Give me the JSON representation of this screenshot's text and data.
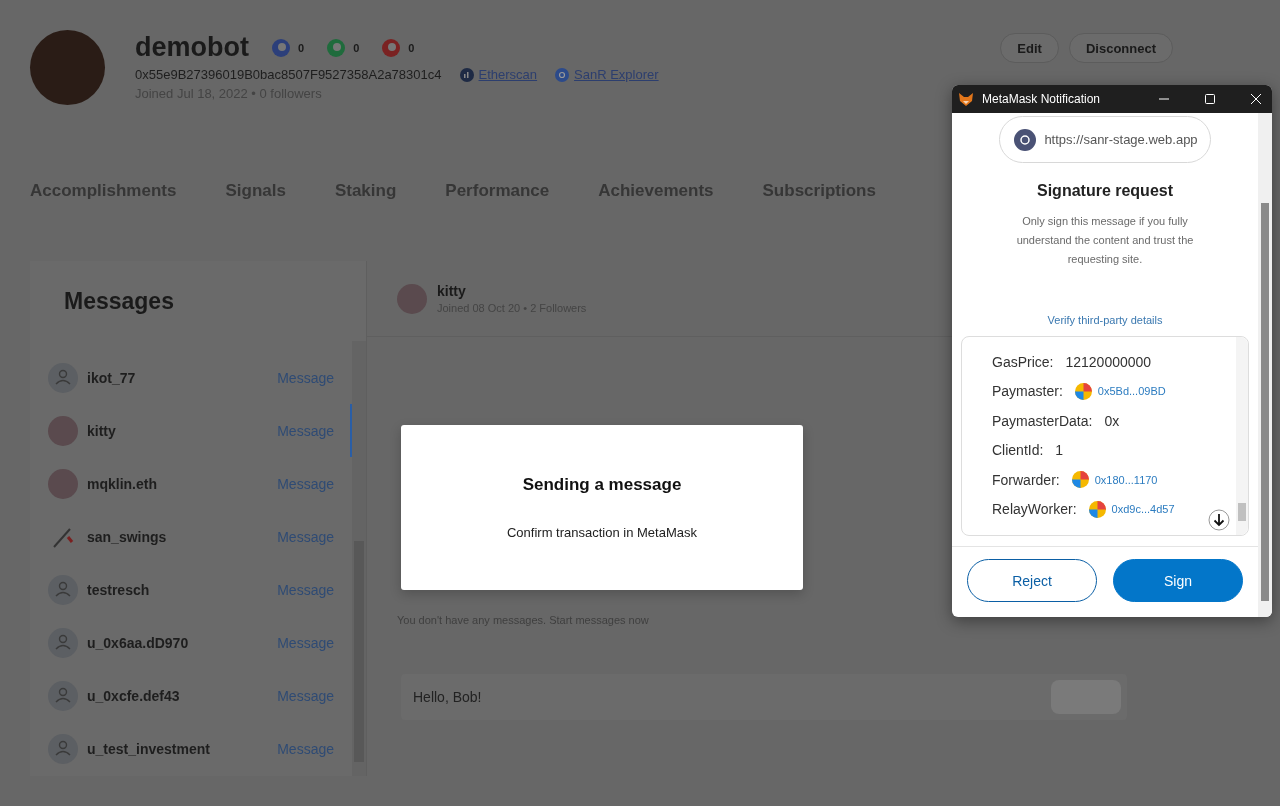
{
  "profile": {
    "name": "demobot",
    "badges": [
      {
        "kind": "blue",
        "count": "0"
      },
      {
        "kind": "green",
        "count": "0"
      },
      {
        "kind": "red",
        "count": "0"
      }
    ],
    "address": "0x55e9B27396019B0bac8507F9527358A2a78301c4",
    "links": [
      {
        "kind": "etherscan",
        "label": "Etherscan"
      },
      {
        "kind": "sanr",
        "label": "SanR Explorer"
      }
    ],
    "joined": "Joined Jul 18, 2022 • 0 followers"
  },
  "header_buttons": [
    "Edit",
    "Disconnect"
  ],
  "tabs": [
    "Accomplishments",
    "Signals",
    "Staking",
    "Performance",
    "Achievements",
    "Subscriptions"
  ],
  "messages": {
    "title": "Messages",
    "contacts": [
      {
        "name": "ikot_77",
        "kind": "default",
        "action": "Message",
        "selected": false
      },
      {
        "name": "kitty",
        "kind": "photo",
        "action": "Message",
        "selected": true
      },
      {
        "name": "mqklin.eth",
        "kind": "photo",
        "action": "Message",
        "selected": false
      },
      {
        "name": "san_swings",
        "kind": "sketch",
        "action": "Message",
        "selected": false
      },
      {
        "name": "testresch",
        "kind": "default",
        "action": "Message",
        "selected": false
      },
      {
        "name": "u_0x6aa.dD970",
        "kind": "default",
        "action": "Message",
        "selected": false
      },
      {
        "name": "u_0xcfe.def43",
        "kind": "default",
        "action": "Message",
        "selected": false
      },
      {
        "name": "u_test_investment",
        "kind": "default",
        "action": "Message",
        "selected": false
      }
    ]
  },
  "chat": {
    "name": "kitty",
    "meta": "Joined 08 Oct 20 • 2 Followers",
    "empty_text": "You don't have any messages. Start messages now",
    "input_value": "Hello, Bob!"
  },
  "modal": {
    "title": "Sending a message",
    "text": "Confirm transaction in MetaMask"
  },
  "metamask": {
    "window_title": "MetaMask Notification",
    "origin": "https://sanr-stage.web.app",
    "title": "Signature request",
    "description": "Only sign this message if you fully understand the content and trust the requesting site.",
    "verify_link": "Verify third-party details",
    "fields": [
      {
        "kind": "text",
        "label": "GasPrice:",
        "value": "12120000000"
      },
      {
        "kind": "address",
        "label": "Paymaster:",
        "value": "0x5Bd...09BD"
      },
      {
        "kind": "text",
        "label": "PaymasterData:",
        "value": "0x"
      },
      {
        "kind": "text",
        "label": "ClientId:",
        "value": "1"
      },
      {
        "kind": "address",
        "label": "Forwarder:",
        "value": "0x180...1170"
      },
      {
        "kind": "address",
        "label": "RelayWorker:",
        "value": "0xd9c...4d57"
      }
    ],
    "buttons": [
      {
        "kind": "secondary",
        "label": "Reject"
      },
      {
        "kind": "primary",
        "label": "Sign"
      }
    ]
  }
}
